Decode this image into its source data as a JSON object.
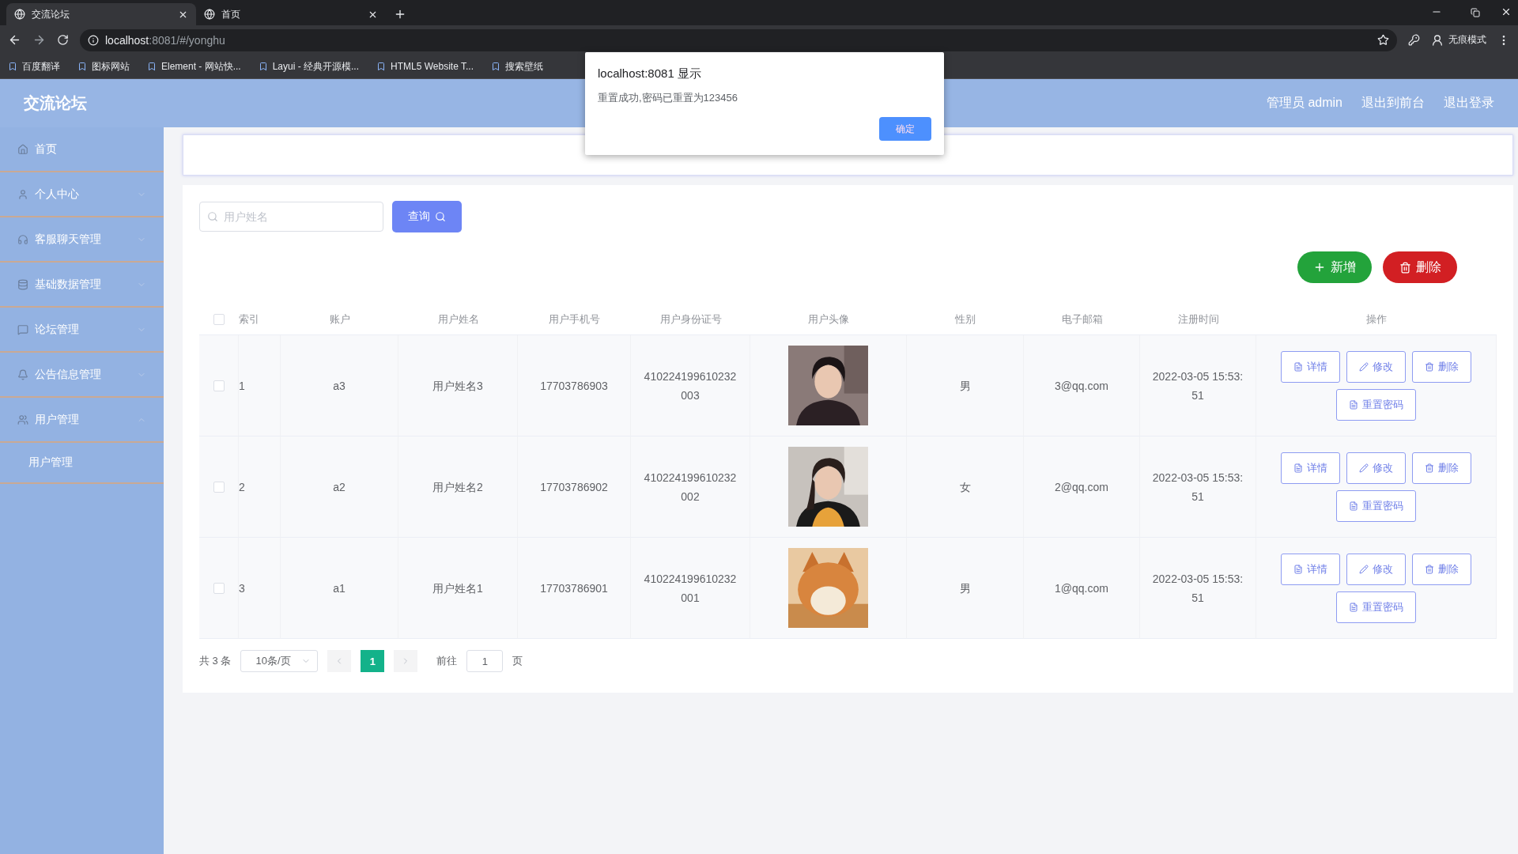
{
  "browser": {
    "tabs": [
      {
        "title": "交流论坛",
        "selected": true
      },
      {
        "title": "首页",
        "selected": false
      }
    ],
    "address": {
      "host": "localhost",
      "rest": ":8081/#/yonghu"
    },
    "bookmarks": [
      "百度翻译",
      "图标网站",
      "Element - 网站快...",
      "Layui - 经典开源模...",
      "HTML5 Website T...",
      "搜索壁纸"
    ],
    "profile": "无痕模式"
  },
  "app": {
    "title": "交流论坛",
    "header_links": [
      "管理员 admin",
      "退出到前台",
      "退出登录"
    ]
  },
  "sidebar": {
    "items": [
      {
        "label": "首页",
        "has_arrow": false
      },
      {
        "label": "个人中心",
        "expanded": false,
        "has_arrow": true
      },
      {
        "label": "客服聊天管理",
        "expanded": false,
        "has_arrow": true
      },
      {
        "label": "基础数据管理",
        "expanded": false,
        "has_arrow": true
      },
      {
        "label": "论坛管理",
        "expanded": false,
        "has_arrow": true
      },
      {
        "label": "公告信息管理",
        "expanded": false,
        "has_arrow": true
      },
      {
        "label": "用户管理",
        "expanded": true,
        "has_arrow": true,
        "children": [
          {
            "label": "用户管理"
          }
        ]
      }
    ]
  },
  "search": {
    "placeholder": "用户姓名",
    "button": "查询"
  },
  "actions": [
    {
      "kind": "add",
      "label": "新增"
    },
    {
      "kind": "delete",
      "label": "删除"
    }
  ],
  "table": {
    "checked": false,
    "columns": [
      "索引",
      "账户",
      "用户姓名",
      "用户手机号",
      "用户身份证号",
      "用户头像",
      "性别",
      "电子邮箱",
      "注册时间",
      "操作"
    ],
    "rows": [
      {
        "checked": false,
        "index": "1",
        "account": "a3",
        "name": "用户姓名3",
        "phone": "17703786903",
        "id_number": "410224199610232003",
        "gender": "男",
        "email": "3@qq.com",
        "registered": "2022-03-05 15:53:51",
        "actions": [
          "详情",
          "修改",
          "删除",
          "重置密码"
        ]
      },
      {
        "checked": false,
        "index": "2",
        "account": "a2",
        "name": "用户姓名2",
        "phone": "17703786902",
        "id_number": "410224199610232002",
        "gender": "女",
        "email": "2@qq.com",
        "registered": "2022-03-05 15:53:51",
        "actions": [
          "详情",
          "修改",
          "删除",
          "重置密码"
        ]
      },
      {
        "checked": false,
        "index": "3",
        "account": "a1",
        "name": "用户姓名1",
        "phone": "17703786901",
        "id_number": "410224199610232001",
        "gender": "男",
        "email": "1@qq.com",
        "registered": "2022-03-05 15:53:51",
        "actions": [
          "详情",
          "修改",
          "删除",
          "重置密码"
        ]
      }
    ]
  },
  "pagination": {
    "total": "共 3 条",
    "page_size": "10条/页",
    "pages": [
      {
        "label": "1",
        "selected": true
      }
    ],
    "goto_label": "前往",
    "goto_value": "1",
    "goto_suffix": "页"
  },
  "dialog": {
    "title": "localhost:8081 显示",
    "message": "重置成功,密码已重置为123456",
    "button": "确定"
  }
}
